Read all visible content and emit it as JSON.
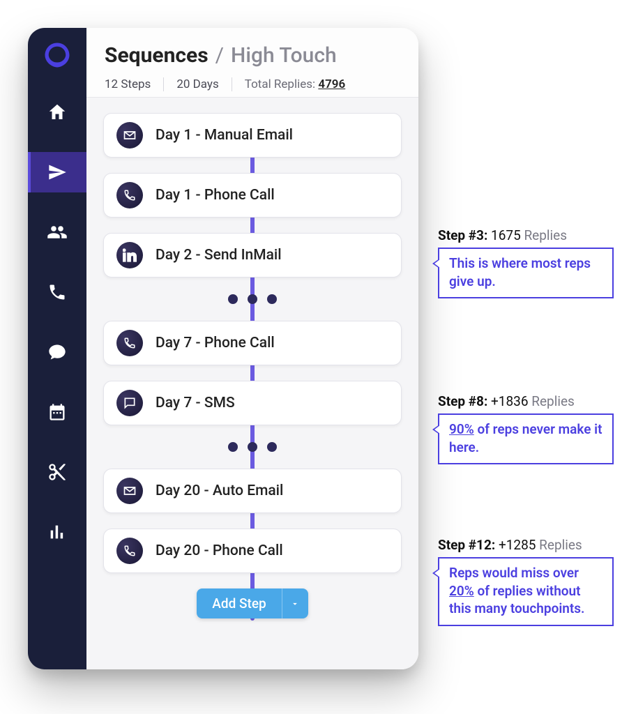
{
  "breadcrumb": {
    "root": "Sequences",
    "separator": "/",
    "current": "High Touch"
  },
  "meta": {
    "steps_label": "12 Steps",
    "days_label": "20 Days",
    "replies_label": "Total Replies:",
    "replies_value": "4796"
  },
  "steps": [
    {
      "icon": "mail",
      "label": "Day 1 - Manual Email"
    },
    {
      "icon": "phone",
      "label": "Day 1 - Phone Call"
    },
    {
      "icon": "linkedin",
      "label": "Day 2 - Send InMail"
    },
    {
      "icon": "phone",
      "label": "Day 7 - Phone Call"
    },
    {
      "icon": "sms",
      "label": "Day 7 - SMS"
    },
    {
      "icon": "mail",
      "label": "Day 20 - Auto Email"
    },
    {
      "icon": "phone",
      "label": "Day 20 - Phone Call"
    }
  ],
  "add_step_label": "Add Step",
  "callouts": [
    {
      "step_prefix": "Step #3:",
      "count": "1675",
      "suffix": "Replies",
      "text_before": "This is where most reps give up.",
      "underline": "",
      "text_after": ""
    },
    {
      "step_prefix": "Step #8:",
      "count": "+1836",
      "suffix": "Replies",
      "text_before": "",
      "underline": "90%",
      "text_after": " of reps never make it here."
    },
    {
      "step_prefix": "Step #12:",
      "count": "+1285",
      "suffix": "Replies",
      "text_before": "Reps would miss over ",
      "underline": "20%",
      "text_after": " of replies without this many touchpoints."
    }
  ],
  "sidebar": {
    "items": [
      "logo",
      "home",
      "send",
      "people",
      "phone",
      "chat",
      "calendar",
      "scissors",
      "analytics"
    ]
  }
}
